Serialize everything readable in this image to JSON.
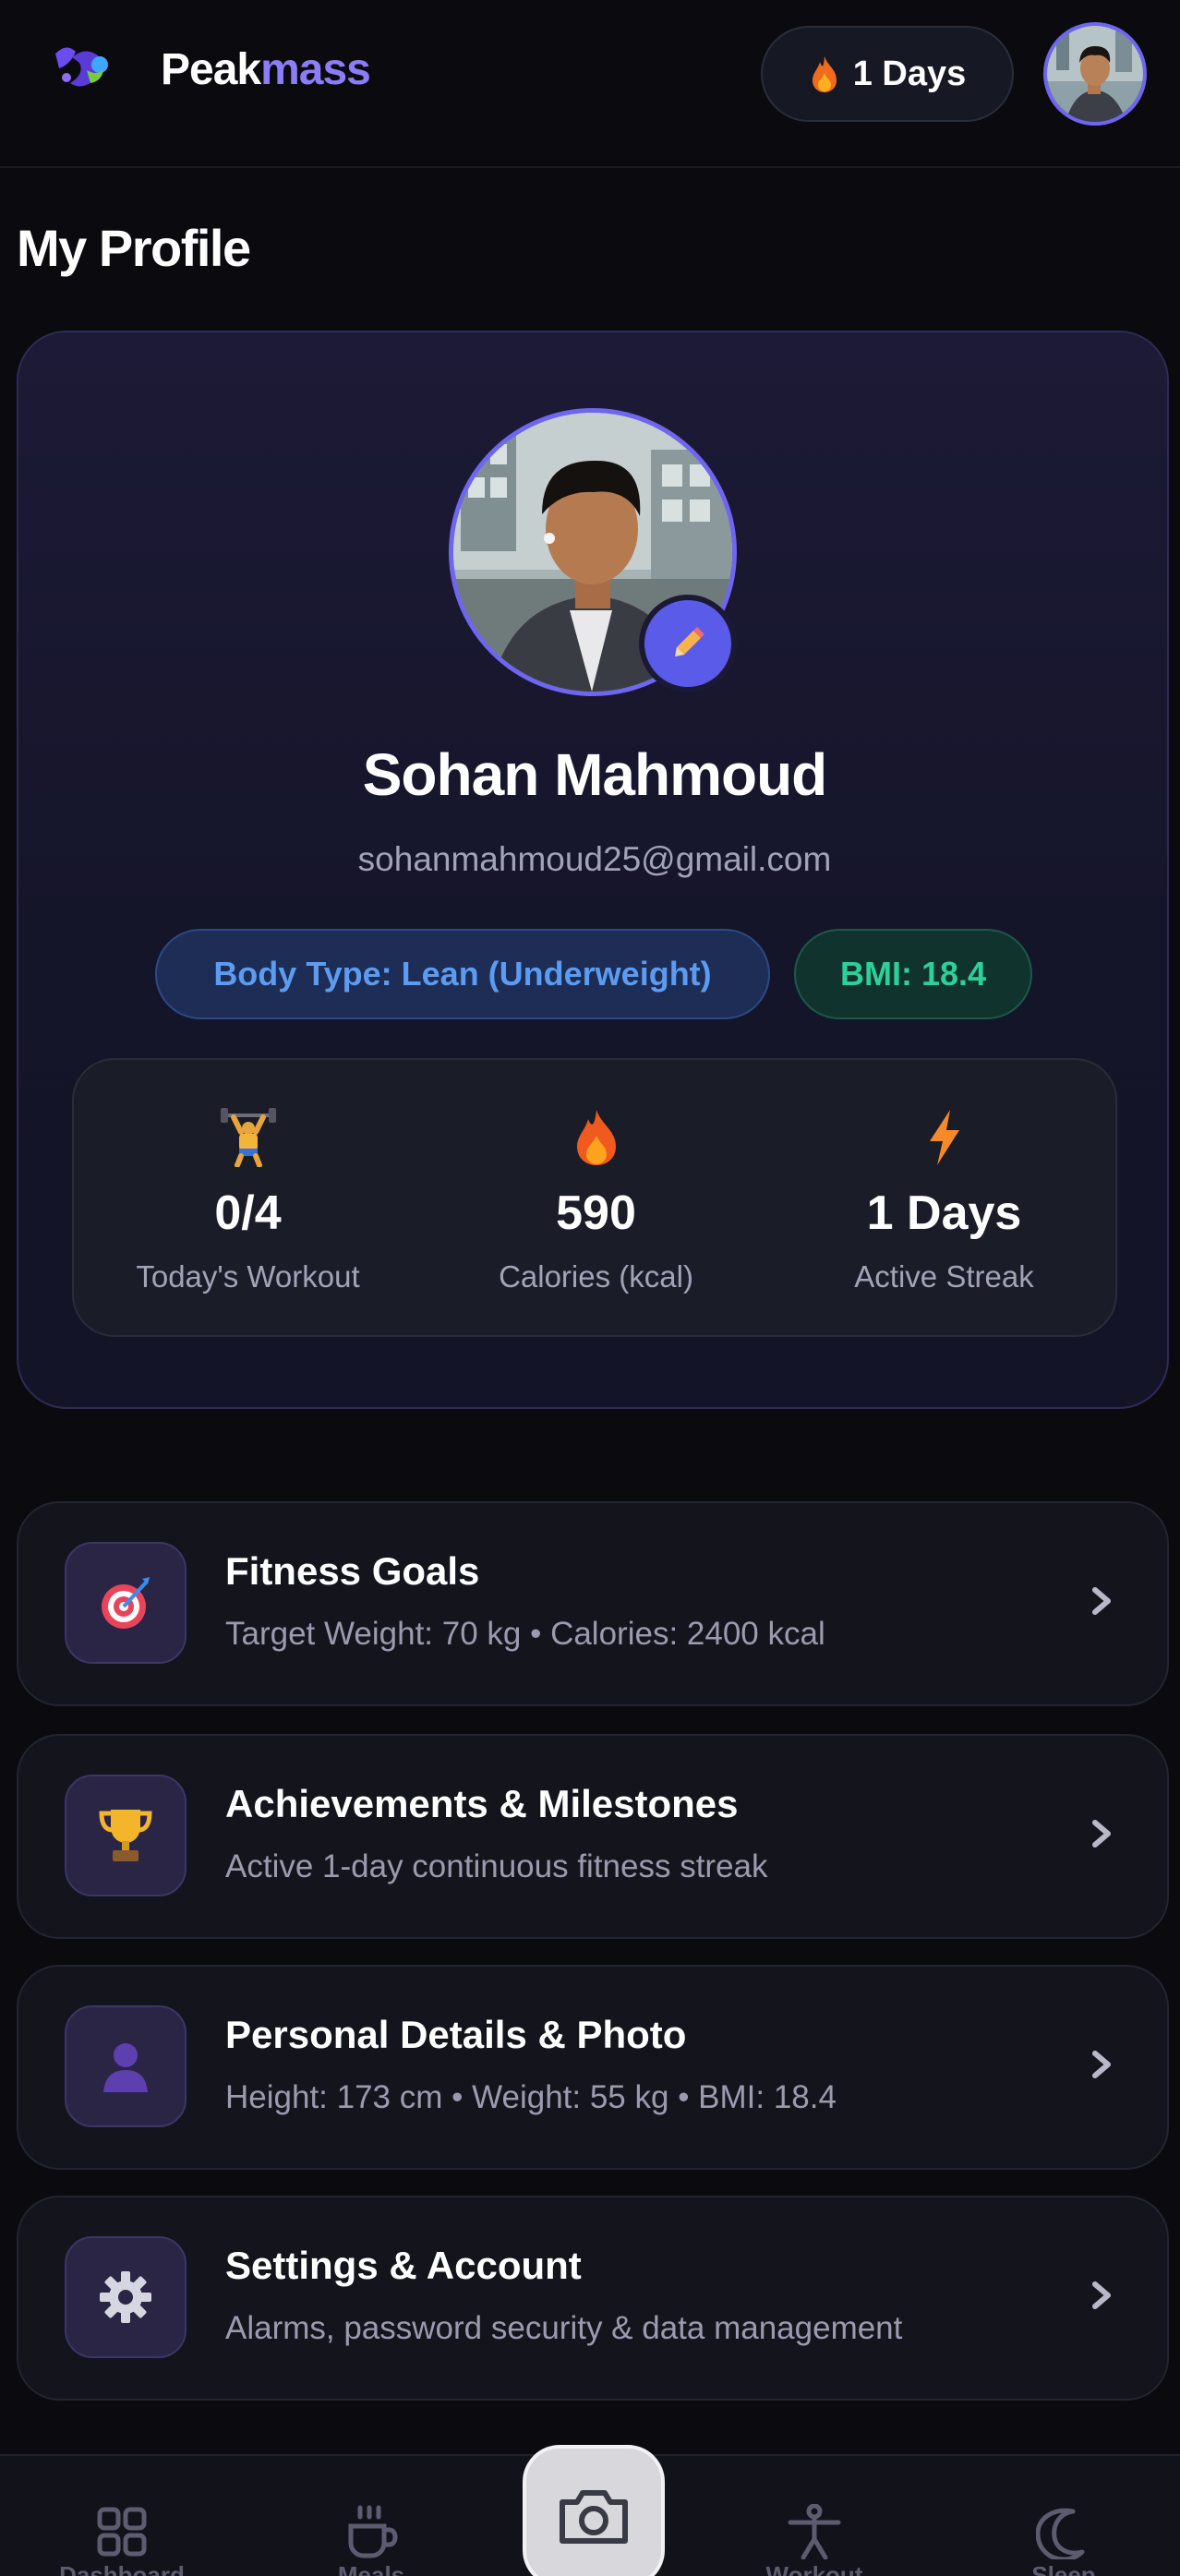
{
  "header": {
    "brand_part1": "Peak",
    "brand_part2": "mass",
    "streak_label": "1 Days"
  },
  "page_title": "My Profile",
  "profile": {
    "name": "Sohan Mahmoud",
    "email": "sohanmahmoud25@gmail.com",
    "body_type_badge": "Body Type: Lean (Underweight)",
    "bmi_badge": "BMI: 18.4",
    "stats": [
      {
        "icon": "weightlifter-icon",
        "value": "0/4",
        "label": "Today's Workout"
      },
      {
        "icon": "fire-icon",
        "value": "590",
        "label": "Calories (kcal)"
      },
      {
        "icon": "lightning-icon",
        "value": "1 Days",
        "label": "Active Streak"
      }
    ]
  },
  "menu": [
    {
      "icon": "target-icon",
      "title": "Fitness Goals",
      "subtitle": "Target Weight: 70 kg • Calories: 2400 kcal"
    },
    {
      "icon": "trophy-icon",
      "title": "Achievements & Milestones",
      "subtitle": "Active 1-day continuous fitness streak"
    },
    {
      "icon": "person-icon",
      "title": "Personal Details & Photo",
      "subtitle": "Height: 173 cm • Weight: 55 kg • BMI: 18.4"
    },
    {
      "icon": "gear-icon",
      "title": "Settings & Account",
      "subtitle": "Alarms, password security & data management"
    }
  ],
  "bottom_nav": [
    {
      "icon": "grid-icon",
      "label": "Dashboard"
    },
    {
      "icon": "cup-icon",
      "label": "Meals"
    },
    {
      "icon": "camera-icon",
      "label": ""
    },
    {
      "icon": "workout-icon",
      "label": "Workout"
    },
    {
      "icon": "moon-icon",
      "label": "Sleep"
    }
  ],
  "colors": {
    "accent": "#6e66f0",
    "brand_highlight": "#8b7cf8",
    "body_type_text": "#5b9cf2",
    "bmi_text": "#2ed09a"
  }
}
